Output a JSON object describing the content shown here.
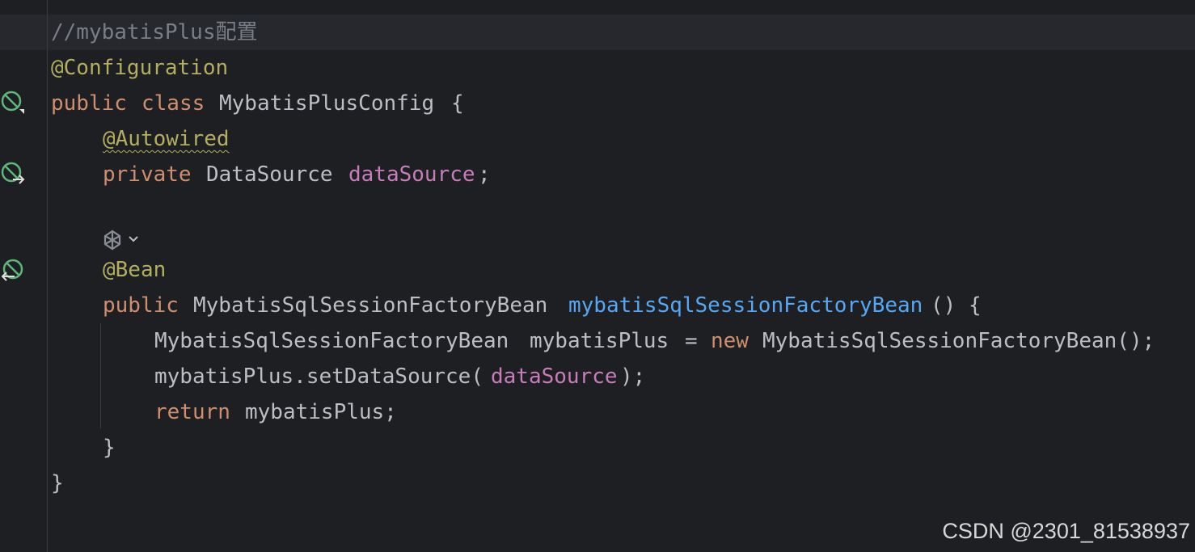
{
  "editor": {
    "lines": {
      "l1": {
        "comment": "//mybatisPlus配置"
      },
      "l2": {
        "annotation": "@Configuration"
      },
      "l3": {
        "kw1": "public",
        "kw2": "class",
        "class_name": "MybatisPlusConfig",
        "brace": "{"
      },
      "l4": {
        "annotation": "@Autowired"
      },
      "l5": {
        "kw": "private",
        "type": "DataSource",
        "field": "dataSource",
        "semi": ";"
      },
      "l7": {
        "annotation": "@Bean"
      },
      "l8": {
        "kw": "public",
        "type": "MybatisSqlSessionFactoryBean",
        "method": "mybatisSqlSessionFactoryBean",
        "rest": "() {"
      },
      "l9": {
        "type": "MybatisSqlSessionFactoryBean",
        "var": "mybatisPlus",
        "eq": "=",
        "kw": "new",
        "ctor": "MybatisSqlSessionFactoryBean();"
      },
      "l10": {
        "call": "mybatisPlus.setDataSource(",
        "field": "dataSource",
        "end": ");"
      },
      "l11": {
        "kw": "return",
        "rest": "mybatisPlus;"
      },
      "l12": {
        "brace": "}"
      },
      "l13": {
        "brace": "}"
      }
    },
    "gutter_icons": [
      "spring-bean-icon",
      "autowired-injection-icon",
      "bean-provider-icon"
    ],
    "inlay_icon": "ai-assistant-icon"
  },
  "watermark": "CSDN @2301_81538937",
  "colors": {
    "background": "#1e1f22",
    "keyword": "#cf8e6d",
    "annotation": "#b3ae60",
    "field": "#c77dbb",
    "method": "#56a8f5",
    "comment": "#7a7e85",
    "text": "#bcbec4",
    "gutter_icon": "#5fb878"
  }
}
